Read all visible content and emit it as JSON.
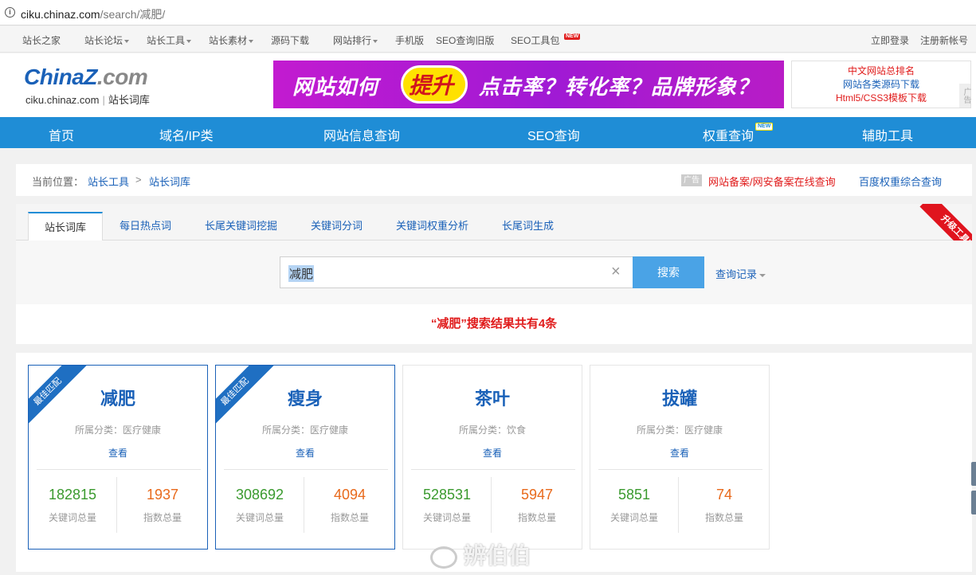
{
  "browser": {
    "url_domain": "ciku.chinaz.com",
    "url_path": "/search/减肥/"
  },
  "top_nav": {
    "items": [
      "站长之家",
      "站长论坛",
      "站长工具",
      "站长素材",
      "源码下载",
      "网站排行",
      "手机版",
      "SEO查询旧版",
      "SEO工具包"
    ],
    "new_badge": "NEW",
    "login": "立即登录",
    "register": "注册新帐号"
  },
  "header": {
    "logo_text_a": "China",
    "logo_text_z": "Z",
    "logo_text_b": ".com",
    "logo_domain": "ciku.chinaz.com",
    "logo_sep": "|",
    "logo_name": "站长词库",
    "banner": {
      "part1": "网站如何",
      "highlight": "提升",
      "part2": "点击率？转化率？品牌形象？"
    },
    "side_links": [
      "中文网站总排名",
      "网站各类源码下载",
      "Html5/CSS3模板下载"
    ],
    "side_ad": "广告"
  },
  "main_nav": {
    "items": [
      "首页",
      "域名/IP类",
      "网站信息查询",
      "SEO查询",
      "权重查询",
      "辅助工具"
    ],
    "new_badge": "NEW"
  },
  "breadcrumb": {
    "label": "当前位置：",
    "items": [
      "站长工具",
      "站长词库"
    ],
    "separator": ">",
    "ad_tag": "广告",
    "ad_link": "网站备案/网安备案在线查询",
    "link2": "百度权重综合查询"
  },
  "tabs": [
    "站长词库",
    "每日热点词",
    "长尾关键词挖掘",
    "关键词分词",
    "关键词权重分析",
    "长尾词生成"
  ],
  "vip_ribbon": "升级工具VIP",
  "search": {
    "value": "减肥",
    "clear": "×",
    "button": "搜索",
    "history": "查询记录"
  },
  "result_summary": "“减肥”搜索结果共有4条",
  "cards": [
    {
      "badge": "最佳匹配",
      "title": "减肥",
      "category": "所属分类：医疗健康",
      "view": "查看",
      "keywords": "182815",
      "index": "1937",
      "keywords_label": "关键词总量",
      "index_label": "指数总量"
    },
    {
      "badge": "最佳匹配",
      "title": "瘦身",
      "category": "所属分类：医疗健康",
      "view": "查看",
      "keywords": "308692",
      "index": "4094",
      "keywords_label": "关键词总量",
      "index_label": "指数总量"
    },
    {
      "badge": "",
      "title": "茶叶",
      "category": "所属分类：饮食",
      "view": "查看",
      "keywords": "528531",
      "index": "5947",
      "keywords_label": "关键词总量",
      "index_label": "指数总量"
    },
    {
      "badge": "",
      "title": "拔罐",
      "category": "所属分类：医疗健康",
      "view": "查看",
      "keywords": "5851",
      "index": "74",
      "keywords_label": "关键词总量",
      "index_label": "指数总量"
    }
  ],
  "watermark": "辨伯伯"
}
